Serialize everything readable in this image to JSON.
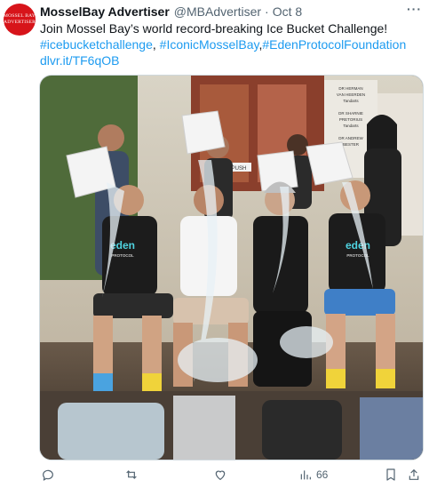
{
  "tweet": {
    "avatar_text": [
      "MOSSEL BAY",
      "ADVERTISER"
    ],
    "author_name": "MosselBay Advertiser",
    "handle": "@MBAdvertiser",
    "separator": "·",
    "date": "Oct 8",
    "more_label": "···",
    "text": "Join Mossel Bay’s world record-breaking Ice Bucket Challenge!",
    "hashtags": [
      "#icebucketchallenge",
      "#IconicMosselBay",
      "#EdenProtocolFoundation"
    ],
    "hashtag_separators": [
      ", ",
      ","
    ],
    "link": "dlvr.it/TF6qOB",
    "media": {
      "sign_lines": [
        "DR HERMAN",
        "VAN HEERDEN",
        "Tandarts",
        "DR SHARNIE",
        "PRETORIUS",
        "Tandarts",
        "DR ANDREW",
        "BESTER"
      ],
      "shirt_logo": "eden",
      "shirt_logo_sub": "PROTOCOL",
      "sign_small": "PUSH"
    },
    "actions": {
      "views_count": "66"
    },
    "icons": [
      "reply-icon",
      "retweet-icon",
      "like-icon",
      "views-icon",
      "bookmark-icon",
      "share-icon"
    ],
    "colors": {
      "link": "#1d9bf0",
      "muted": "#536471",
      "brand_red": "#d7141a"
    }
  }
}
